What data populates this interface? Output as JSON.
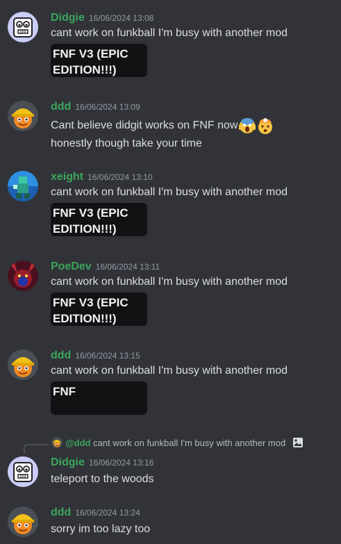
{
  "colors": {
    "background": "#313338",
    "username": "#3ba55d",
    "spoiler_bg": "#111214",
    "timestamp": "#949ba4"
  },
  "messages": [
    {
      "user": "Didgie",
      "time": "16/06/2024 13:08",
      "text": "cant work on funkball I'm busy with another mod",
      "attachment": "FNF V3 (EPIC EDITION!!!)",
      "avatar": "robot-avatar"
    },
    {
      "user": "ddd",
      "time": "16/06/2024 13:09",
      "text": "Cant believe didgit works on FNF now",
      "emoji": [
        "screaming-face-emoji",
        "exploding-head-emoji"
      ],
      "text2": "honestly though take your time",
      "avatar": "construction-worker-avatar"
    },
    {
      "user": "xeight",
      "time": "16/06/2024 13:10",
      "text": "cant work on funkball I'm busy with another mod",
      "attachment": "FNF V3 (EPIC EDITION!!!)",
      "avatar": "pixel-character-avatar"
    },
    {
      "user": "PoeDev",
      "time": "16/06/2024 13:11",
      "text": "cant work on funkball I'm busy with another mod",
      "attachment": "FNF V3 (EPIC EDITION!!!)",
      "avatar": "red-creature-avatar"
    },
    {
      "user": "ddd",
      "time": "16/06/2024 13:15",
      "text": "cant work on funkball I'm busy with another mod",
      "attachment": "FNF",
      "avatar": "construction-worker-avatar"
    },
    {
      "user": "Didgie",
      "time": "16/06/2024 13:16",
      "text": "teleport to the woods",
      "reply": {
        "mention": "@ddd",
        "text": "cant work on funkball I'm busy with another mod"
      },
      "avatar": "robot-avatar"
    },
    {
      "user": "ddd",
      "time": "16/06/2024 13:24",
      "text": "sorry im too lazy too",
      "avatar": "construction-worker-avatar"
    }
  ]
}
